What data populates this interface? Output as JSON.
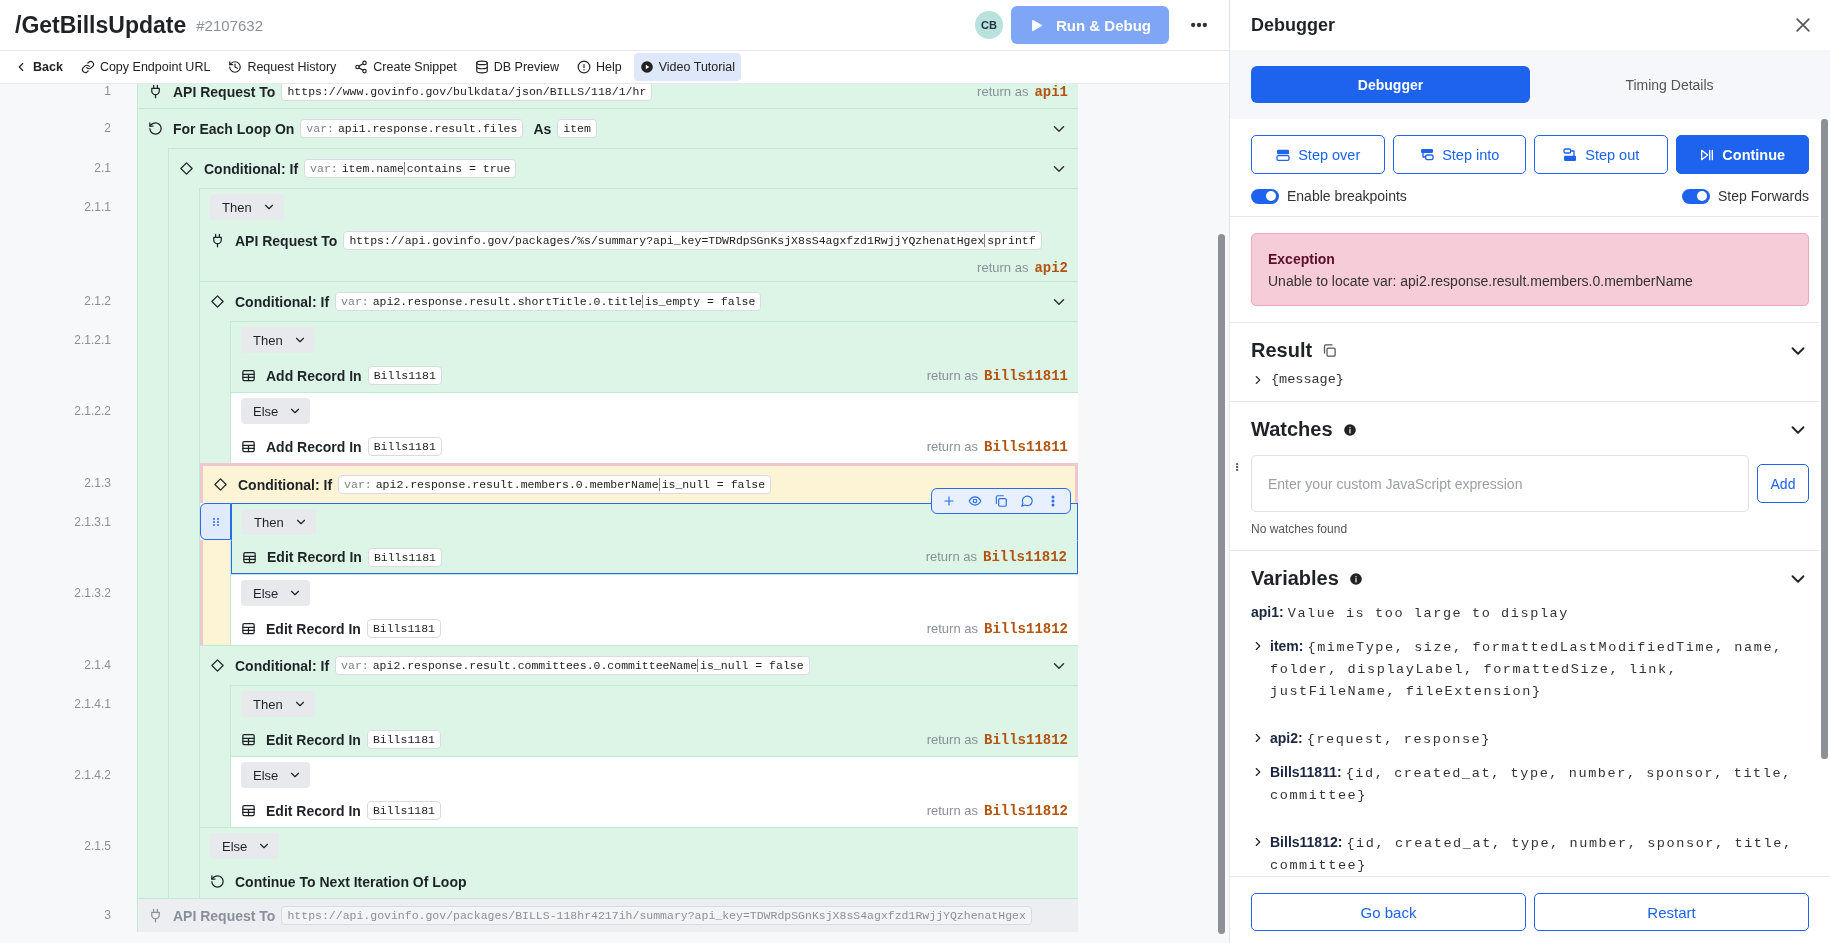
{
  "header": {
    "title": "/GetBillsUpdate",
    "id": "#2107632",
    "avatar": "CB",
    "run_button": {
      "label": "Run & Debug",
      "disabled": true
    }
  },
  "toolbar": [
    {
      "label": "Back",
      "selected": false
    },
    {
      "label": "Copy Endpoint URL",
      "selected": false
    },
    {
      "label": "Request History",
      "selected": false
    },
    {
      "label": "Create Snippet",
      "selected": false
    },
    {
      "label": "DB Preview",
      "selected": false
    },
    {
      "label": "Help",
      "selected": false
    },
    {
      "label": "Video Tutorial",
      "selected": true
    }
  ],
  "flow": [
    {
      "kind": "api",
      "number": "1",
      "label": "API Request To",
      "value": "https://www.govinfo.gov/bulkdata/json/BILLS/118/1/hr",
      "return_label": "return as",
      "return_var": "api1",
      "disabled": false
    },
    {
      "kind": "loop",
      "number": "2",
      "label": "For Each Loop On",
      "var_prefix": "var:",
      "value": "api1.response.result.files",
      "as_label": "As",
      "as_value": "item",
      "expanded": true,
      "children": [
        {
          "kind": "conditional",
          "number": "2.1",
          "label": "Conditional: If",
          "var_prefix": "var:",
          "value": "item.name",
          "operator": "contains",
          "comparison": "= true",
          "expanded": true,
          "paused": false,
          "children": [
            {
              "kind": "branch",
              "number": "2.1.1",
              "label": "Then",
              "selected": false,
              "children": [
                {
                  "kind": "api",
                  "label": "API Request To",
                  "value": "https://api.govinfo.gov/packages/%s/summary?api_key=TDWRdpSGnKsjX8sS4agxfzd1RwjjYQzhenatHgex",
                  "operator": "sprintf",
                  "return_label": "return as",
                  "return_var": "api2",
                  "disabled": false
                },
                {
                  "kind": "conditional",
                  "number": "2.1.2",
                  "label": "Conditional: If",
                  "var_prefix": "var:",
                  "value": "api2.response.result.shortTitle.0.title",
                  "operator": "is_empty",
                  "comparison": "= false",
                  "expanded": true,
                  "paused": false,
                  "children": [
                    {
                      "kind": "branch",
                      "number": "2.1.2.1",
                      "label": "Then",
                      "selected": false,
                      "children": [
                        {
                          "kind": "record",
                          "label": "Add Record In",
                          "value": "Bills1181",
                          "return_label": "return as",
                          "return_var": "Bills11811"
                        }
                      ]
                    },
                    {
                      "kind": "branch",
                      "number": "2.1.2.2",
                      "label": "Else",
                      "selected": false,
                      "children": [
                        {
                          "kind": "record",
                          "label": "Add Record In",
                          "value": "Bills1181",
                          "return_label": "return as",
                          "return_var": "Bills11811"
                        }
                      ]
                    }
                  ]
                },
                {
                  "kind": "conditional",
                  "number": "2.1.3",
                  "label": "Conditional: If",
                  "var_prefix": "var:",
                  "value": "api2.response.result.members.0.memberName",
                  "operator": "is_null",
                  "comparison": "= false",
                  "paused": true,
                  "children": [
                    {
                      "kind": "branch",
                      "number": "2.1.3.1",
                      "label": "Then",
                      "selected": true,
                      "children": [
                        {
                          "kind": "record",
                          "label": "Edit Record In",
                          "value": "Bills1181",
                          "return_label": "return as",
                          "return_var": "Bills11812"
                        }
                      ]
                    },
                    {
                      "kind": "branch",
                      "number": "2.1.3.2",
                      "label": "Else",
                      "selected": false,
                      "children": [
                        {
                          "kind": "record",
                          "label": "Edit Record In",
                          "value": "Bills1181",
                          "return_label": "return as",
                          "return_var": "Bills11812"
                        }
                      ]
                    }
                  ]
                },
                {
                  "kind": "conditional",
                  "number": "2.1.4",
                  "label": "Conditional: If",
                  "var_prefix": "var:",
                  "value": "api2.response.result.committees.0.committeeName",
                  "operator": "is_null",
                  "comparison": "= false",
                  "expanded": true,
                  "paused": false,
                  "children": [
                    {
                      "kind": "branch",
                      "number": "2.1.4.1",
                      "label": "Then",
                      "selected": false,
                      "children": [
                        {
                          "kind": "record",
                          "label": "Edit Record In",
                          "value": "Bills1181",
                          "return_label": "return as",
                          "return_var": "Bills11812"
                        }
                      ]
                    },
                    {
                      "kind": "branch",
                      "number": "2.1.4.2",
                      "label": "Else",
                      "selected": false,
                      "children": [
                        {
                          "kind": "record",
                          "label": "Edit Record In",
                          "value": "Bills1181",
                          "return_label": "return as",
                          "return_var": "Bills11812"
                        }
                      ]
                    }
                  ]
                }
              ]
            },
            {
              "kind": "branch",
              "number": "2.1.5",
              "label": "Else",
              "selected": false,
              "children": [
                {
                  "kind": "continue",
                  "label": "Continue To Next Iteration Of Loop"
                }
              ]
            }
          ]
        }
      ]
    },
    {
      "kind": "api",
      "number": "3",
      "label": "API Request To",
      "value": "https://api.govinfo.gov/packages/BILLS-118hr4217ih/summary?api_key=TDWRdpSGnKsjX8sS4agxfzd1RwjjYQzhenatHgex",
      "disabled": true
    }
  ],
  "debugger": {
    "title": "Debugger",
    "tabs": [
      {
        "label": "Debugger",
        "selected": true
      },
      {
        "label": "Timing Details",
        "selected": false
      }
    ],
    "controls": [
      {
        "label": "Step over",
        "primary": false
      },
      {
        "label": "Step into",
        "primary": false
      },
      {
        "label": "Step out",
        "primary": false
      },
      {
        "label": "Continue",
        "primary": true
      }
    ],
    "toggles": [
      {
        "label": "Enable breakpoints",
        "on": true
      },
      {
        "label": "Step Forwards",
        "on": true
      }
    ],
    "exception": {
      "title": "Exception",
      "message": "Unable to locate var: api2.response.result.members.0.memberName"
    },
    "result": {
      "title": "Result",
      "expanded": true,
      "items": [
        {
          "value": "{message}",
          "expanded": false
        }
      ]
    },
    "watches": {
      "title": "Watches",
      "expanded": true,
      "placeholder": "Enter your custom JavaScript expression",
      "add_button": "Add",
      "empty_text": "No watches found"
    },
    "variables": {
      "title": "Variables",
      "expanded": true,
      "items": [
        {
          "label": "api1:",
          "value": "Value is too large to display"
        },
        {
          "label": "item:",
          "value": "{mimeType, size, formattedLastModifiedTime, name, folder, displayLabel, formattedSize, link, justFileName, fileExtension}",
          "expanded": false
        },
        {
          "label": "api2:",
          "value": "{request, response}",
          "expanded": false
        },
        {
          "label": "Bills11811:",
          "value": "{id, created_at, type, number, sponsor, title, committee}",
          "expanded": false
        },
        {
          "label": "Bills11812:",
          "value": "{id, created_at, type, number, sponsor, title, committee}",
          "expanded": false
        }
      ]
    },
    "footer": [
      "Go back",
      "Restart"
    ]
  }
}
